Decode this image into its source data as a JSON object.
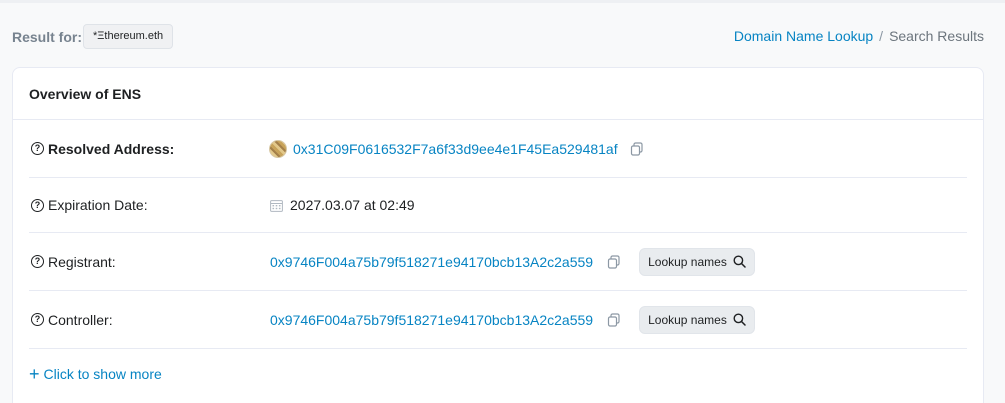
{
  "header": {
    "result_label": "Result for:",
    "domain": "*Ξthereum.eth",
    "breadcrumb": {
      "link": "Domain Name Lookup",
      "separator": "/",
      "current": "Search Results"
    }
  },
  "card": {
    "title": "Overview of ENS",
    "rows": [
      {
        "label": "Resolved Address:",
        "value": "0x31C09F0616532F7a6f33d9ee4e1F45Ea529481af"
      },
      {
        "label": "Expiration Date:",
        "value": "2027.03.07 at 02:49"
      },
      {
        "label": "Registrant:",
        "value": "0x9746F004a75b79f518271e94170bcb13A2c2a559",
        "button": "Lookup names"
      },
      {
        "label": "Controller:",
        "value": "0x9746F004a75b79f518271e94170bcb13A2c2a559",
        "button": "Lookup names"
      }
    ],
    "show_more": "Click to show more"
  },
  "colors": {
    "link": "#0784c3",
    "border": "#e7eaf3",
    "muted": "#77838f"
  },
  "icons": [
    "question-circle-icon",
    "copy-icon",
    "calendar-icon",
    "search-icon",
    "plus-icon",
    "avatar"
  ]
}
